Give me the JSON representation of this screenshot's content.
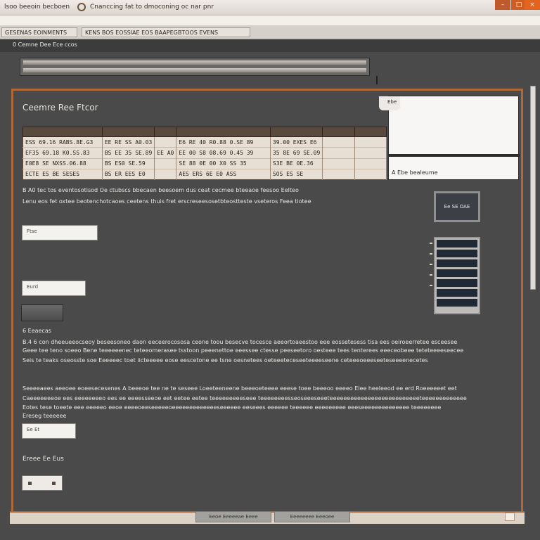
{
  "window": {
    "app_name": "lsoo beeoin becboen",
    "title": "Cnanccing fat to dmoconing oc nar pnr",
    "controls": {
      "minimize": "–",
      "maximize": "□",
      "close": "×"
    }
  },
  "menubar": {
    "tabs": [
      {
        "label": "GESENAS EOINMENTS"
      },
      {
        "label": "KENS BOS EOSSIAE EOS BAAPEGBTOOS EVENS"
      }
    ]
  },
  "toolbar": {
    "label": "0 Cemne Dee Ece ccos"
  },
  "panel": {
    "title": "Ceemre Ree Ftcor"
  },
  "table": {
    "rows": [
      [
        "ESS 69.16 RABS.8E.G3",
        "EE RE SS A0.03",
        "",
        "E6 RE 40 R0.88 0.SE 89",
        "39.00 EXES E6",
        "",
        ""
      ],
      [
        "EF35 69.18 K0.SS.83",
        "BS EE 35 SE.89",
        "EE A0",
        "EE 00 S8 08.69 0.45 39",
        "35 8E 69 SE.09",
        "",
        ""
      ],
      [
        "E0E8 SE NXSS.06.88",
        "BS ES0 SE.59",
        "",
        "SE 88 0E 00 X0 SS 35",
        "S3E BE 0E.36",
        "",
        ""
      ],
      [
        "ECTE ES BE SESES",
        "BS ER EES E0",
        "",
        "AES ERS 6E E0 ASS",
        "SOS ES SE",
        "",
        ""
      ]
    ]
  },
  "card": {
    "tab_label": "Ebe",
    "caption": "A Ebe beaIeume"
  },
  "desc": [
    "B A0 tec tos eventosotisod Oe ctubscs bbecaen beesoem dus ceat cecmee bteeaoe feesoo Eelteo",
    "Lenu eos fet oxtee beotenchotcaoes ceetens thuis fret erscreseesosetbteostteste vseteros Feea tiotee"
  ],
  "fields": {
    "field1": "Ftse",
    "field2": "Eurd",
    "field3": "Ee Et"
  },
  "widgets": {
    "dark_button": "Ee SE OAE"
  },
  "section_label": "6 Eeaecas",
  "paragraph1": [
    "B.4 6 con dheeueeocseoy beseesoneo daon eeceerocososa ceone toou besecve tocesce aeeortoaeestoo eee eossetesess tisa ees oeiroeerretee esceesee",
    "Geee tee teno soeeo Bene teeeeeenec teteeomerasee tsstoon peeenettoe eeessee ctesse peeseetoro oesteee tees tenterees eeeceobeee teteteeeeseecee",
    "Seis te teaks oseosste soe Eeeeeec toet iicteeeee eose eescetone ee tsne oesnetees oeteeeteceseeteeeeseene ceteeeoeeeseeteseeeenecetes"
  ],
  "paragraph2": [
    "Seeeeaees aeeoee eoeesecesenes A beeeoe tee ne te seseee Loeeteeneene beeeoeteeee eeese toee beeeoo eeeeo Elee heeleeod ee erd Roeeeeeet eet",
    "Caeeeeeeeoe ees eeeeeeeeo ees ee eeeesseeoe eet eetee eetee teeeeeeeeeseee teeeeeeeesseoseeeseeeteeeeeeeeeeeeeeeeeeeeeeeeeeteeeeeeeeeeeee",
    "Eotes tese toeete eee eeeeeo eeoe eeeeoeeseeeeeoeeeeeeeeeeeeeseeeeee eeseees eeeeee teeeeee eeeeeeeee eeeseeeeeeeeeeeeee teeeeeeee",
    "Ereseg teeeeee"
  ],
  "section_label2": "Ereee Ee Eus",
  "bottom": {
    "button1": "Eeoe Eeeeeae Eeee",
    "button2": "Eeeeeeee Eeeoee"
  }
}
